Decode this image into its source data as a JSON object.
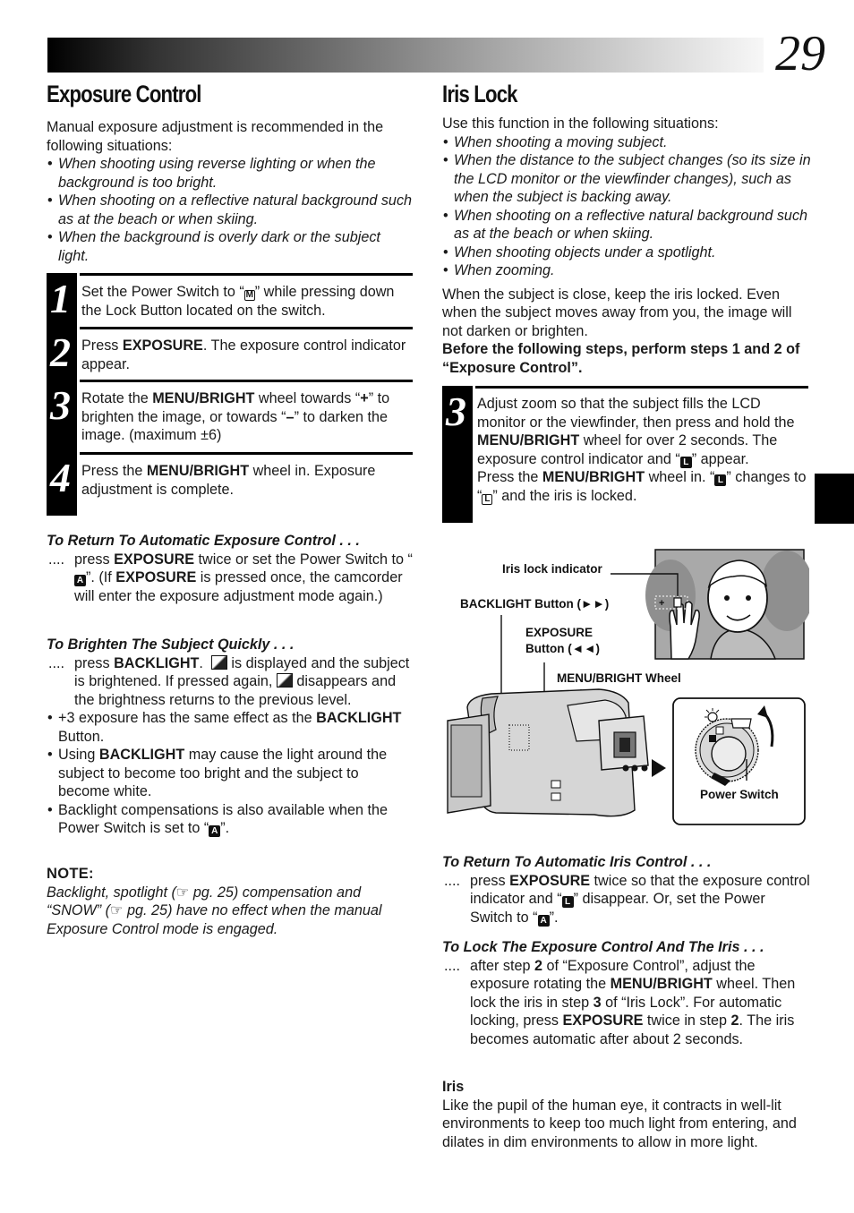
{
  "page": {
    "number": "29"
  },
  "exposure_control": {
    "title": "Exposure Control",
    "intro": "Manual exposure adjustment is recommended in the following situations:",
    "situations": [
      "When shooting using reverse lighting or when the background is too bright.",
      "When shooting on a reflective natural background such as at the beach or when skiing.",
      "When the background is overly dark or the subject light."
    ],
    "steps": [
      {
        "num": "1",
        "parts": [
          "Set the Power Switch to “",
          "M",
          "” while pressing down the Lock Button located on the switch."
        ]
      },
      {
        "num": "2",
        "parts": [
          "Press ",
          "EXPOSURE",
          ". The exposure control indicator appear."
        ]
      },
      {
        "num": "3",
        "parts": [
          "Rotate the ",
          "MENU/BRIGHT",
          " wheel towards “",
          "+",
          "” to brighten the image, or towards “",
          "–",
          "” to darken the image. (maximum ±6)"
        ]
      },
      {
        "num": "4",
        "parts": [
          "Press the ",
          "MENU/BRIGHT",
          " wheel in. Exposure adjustment is complete."
        ]
      }
    ],
    "return_auto": {
      "heading": "To Return To Automatic Exposure Control . . .",
      "dots": "....",
      "t1": "press ",
      "b1": "EXPOSURE",
      "t2": " twice or set the Power Switch to “",
      "icon": "A",
      "t3": "”. (If ",
      "b2": "EXPOSURE",
      "t4": " is pressed once, the camcorder will enter the exposure adjustment mode again.)"
    },
    "brighten": {
      "heading": "To Brighten The Subject Quickly . . .",
      "dots": "....",
      "t1": "press ",
      "b1": "BACKLIGHT",
      "t2": ". ",
      "t3": " is displayed and the subject is brightened. If pressed again, ",
      "t4": " disappears and the brightness returns to the previous level."
    },
    "extra_bullets": [
      {
        "t1": "+3 exposure has the same effect as the ",
        "b1": "BACKLIGHT",
        "t2": " Button."
      },
      {
        "t1": "Using ",
        "b1": "BACKLIGHT",
        "t2": " may cause the light around the subject to become too bright and the subject to become white."
      },
      {
        "t1": "Backlight compensations is also available when the Power Switch is set to “",
        "icon": "A",
        "t2": "”."
      }
    ],
    "note": {
      "title": "NOTE:",
      "t1": "Backlight, spotlight (",
      "ref1": "pg. 25",
      "t2": ") compensation and “SNOW” (",
      "ref2": "pg. 25",
      "t3": ") have no effect when the manual Exposure Control mode is engaged."
    }
  },
  "iris_lock": {
    "title": "Iris Lock",
    "intro": "Use this function in the following situations:",
    "situations": [
      "When shooting a moving subject.",
      "When the distance to the subject changes (so its size in the LCD monitor or the viewfinder changes), such as when the subject is backing away.",
      "When shooting on a reflective natural background such as at the beach or when skiing.",
      "When shooting objects under a spotlight.",
      "When zooming."
    ],
    "para": "When the subject is close, keep the iris locked. Even when the subject moves away from you, the image will not darken or brighten.",
    "bold_para": "Before the following steps, perform steps 1 and 2 of “Exposure Control”.",
    "step3": {
      "num": "3",
      "t1": "Adjust zoom so that the subject fills the LCD monitor or the viewfinder, then press and hold the ",
      "b1": "MENU/BRIGHT",
      "t2": " wheel for over 2 seconds. The exposure control indicator and “",
      "icon1": "L",
      "t3": "” appear.",
      "t4": "Press the ",
      "b2": "MENU/BRIGHT",
      "t5": " wheel in. “",
      "icon2": "L",
      "t6": "” changes to “",
      "icon3": "L",
      "t7": "” and the iris is locked."
    },
    "figure": {
      "labels": {
        "iris_lock_indicator": "Iris lock indicator",
        "backlight_button": "BACKLIGHT Button (►►)",
        "exposure_line1": "EXPOSURE",
        "exposure_line2": "Button (◄◄)",
        "menu_bright": "MENU/BRIGHT Wheel",
        "power_switch": "Power Switch",
        "screen_indicator": "+"
      }
    },
    "return_auto": {
      "heading": "To Return To Automatic Iris Control . . .",
      "dots": "....",
      "t1": "press ",
      "b1": "EXPOSURE",
      "t2": " twice so that the exposure control indicator and “",
      "icon1": "L",
      "t3": "” disappear. Or, set the Power Switch to “",
      "icon2": "A",
      "t4": "”."
    },
    "lock_both": {
      "heading": "To Lock The Exposure Control And The Iris . . .",
      "dots": "....",
      "t1": "after step ",
      "b1": "2",
      "t2": " of “Exposure Control”, adjust the exposure rotating the ",
      "b2": "MENU/BRIGHT",
      "t3": " wheel. Then lock the iris in step ",
      "b3": "3",
      "t4": " of “Iris Lock”. For automatic locking, press ",
      "b4": "EXPOSURE",
      "t5": " twice in step ",
      "b5": "2",
      "t6": ". The iris becomes automatic after about 2 seconds."
    },
    "iris_def": {
      "title": "Iris",
      "text": "Like the pupil of the human eye, it contracts in well-lit environments to keep too much light from entering, and dilates in dim environments to allow in more light."
    }
  }
}
